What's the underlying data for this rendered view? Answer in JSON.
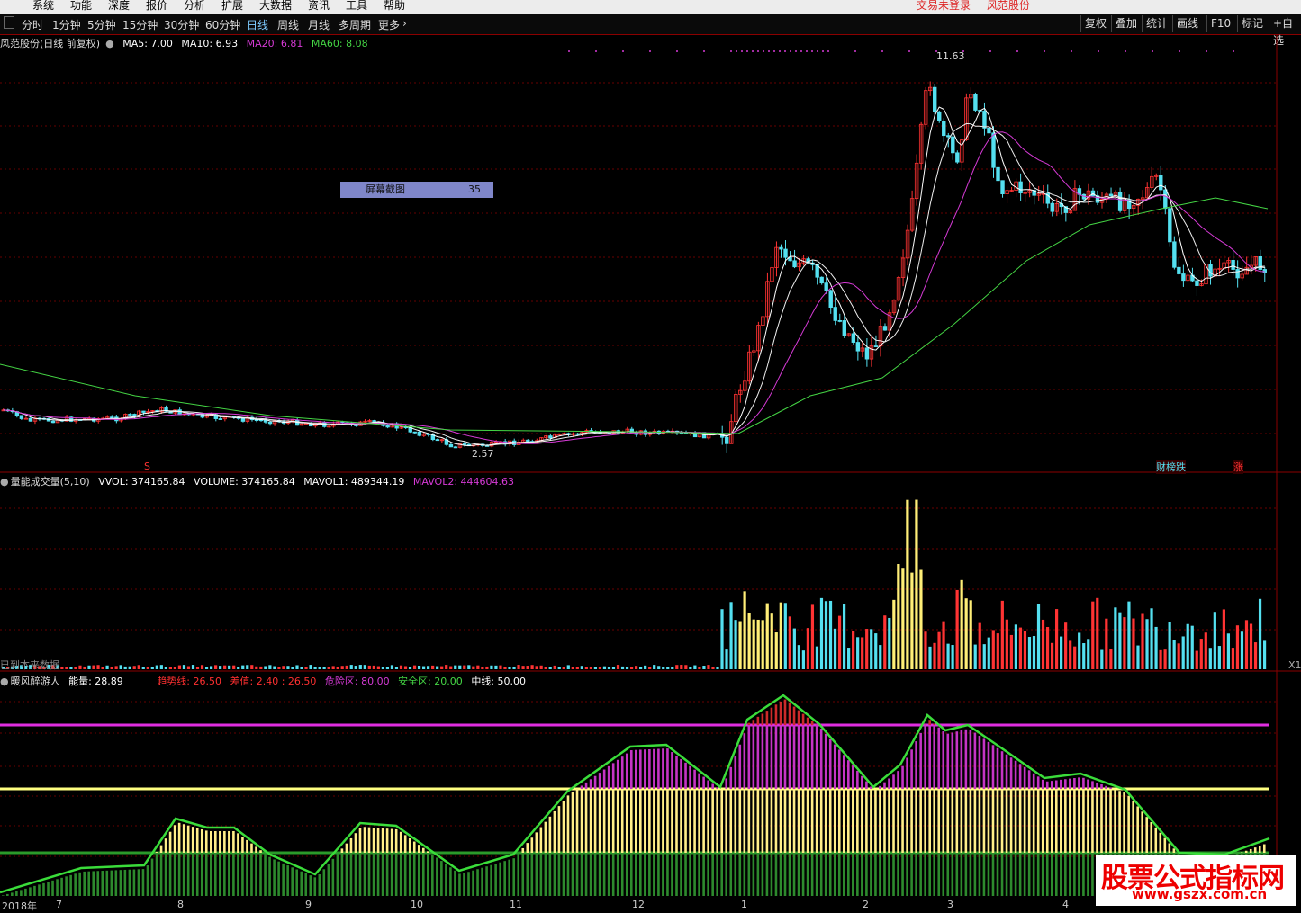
{
  "menu": {
    "items": [
      "系统",
      "功能",
      "深度",
      "报价",
      "分析",
      "扩展",
      "大数据",
      "资讯",
      "工具",
      "帮助"
    ],
    "status_login": "交易未登录",
    "status_stock": "风范股份"
  },
  "toolbar": {
    "periods": [
      "分时",
      "1分钟",
      "5分钟",
      "15分钟",
      "30分钟",
      "60分钟",
      "日线",
      "周线",
      "月线",
      "多周期",
      "更多"
    ],
    "active_period": "日线",
    "right_buttons": [
      "复权",
      "叠加",
      "统计",
      "画线",
      "F10",
      "标记",
      "+自选"
    ]
  },
  "price_panel": {
    "title": "风范股份(日线 前复权)",
    "ma": [
      {
        "label": "MA5: 7.00",
        "color": "#ffffff"
      },
      {
        "label": "MA10: 6.93",
        "color": "#ffffff"
      },
      {
        "label": "MA20: 6.81",
        "color": "#d63ad6"
      },
      {
        "label": "MA60: 8.08",
        "color": "#44d444"
      }
    ],
    "high_label": "11.63",
    "low_label": "2.57",
    "popup_label": "屏幕截图",
    "popup_value": "35",
    "marker_s": "S",
    "tag_bottom_1": "财榜跌",
    "tag_bottom_2": "涨"
  },
  "volume_panel": {
    "title": "量能成交量(5,10)",
    "items": [
      {
        "label": "VVOL: 374165.84",
        "color": "#ffffff"
      },
      {
        "label": "VOLUME: 374165.84",
        "color": "#ffffff"
      },
      {
        "label": "MAVOL1: 489344.19",
        "color": "#ffffff"
      },
      {
        "label": "MAVOL2: 444604.63",
        "color": "#d63ad6"
      }
    ],
    "note": "已到本来数据",
    "corner": "X1"
  },
  "indicator_panel": {
    "title": "暖风醉游人",
    "energy": "能量: 28.89",
    "items": [
      {
        "label": "趋势线: 26.50",
        "color": "#ff3030"
      },
      {
        "label": "差值: 2.40 : 26.50",
        "color": "#ff3030"
      },
      {
        "label": "危险区: 80.00",
        "color": "#d63ad6"
      },
      {
        "label": "安全区: 20.00",
        "color": "#44d444"
      },
      {
        "label": "中线: 50.00",
        "color": "#ffffff"
      }
    ]
  },
  "x_axis": {
    "labels": [
      "2018年",
      "7",
      "8",
      "9",
      "10",
      "11",
      "12",
      "1",
      "2",
      "3",
      "4"
    ]
  },
  "watermark": {
    "title": "股票公式指标网",
    "url": "www.gszx.com.cn"
  },
  "colors": {
    "up": "#ff3333",
    "down": "#54e0f0",
    "ma5": "#ffffff",
    "ma20": "#d63ad6",
    "ma60": "#44d444",
    "grid": "#8b0000"
  }
}
